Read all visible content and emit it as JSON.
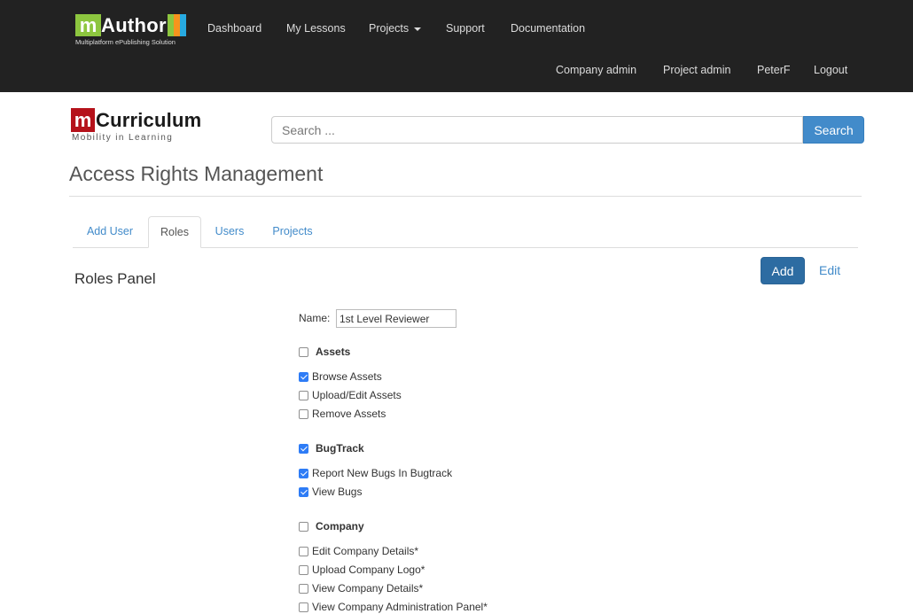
{
  "topnav": {
    "brand": {
      "letter": "m",
      "name": "Author",
      "subtitle": "Multiplatform ePublishing Solution",
      "bar_colors": [
        "#8dc63f",
        "#f7941d",
        "#27aae1"
      ]
    },
    "links": [
      "Dashboard",
      "My Lessons",
      "Projects",
      "Support",
      "Documentation"
    ],
    "user_links": [
      "Company admin",
      "Project admin",
      "PeterF",
      "Logout"
    ]
  },
  "header": {
    "logo": {
      "letter": "m",
      "name": "Curriculum",
      "subtitle": "Mobility in Learning"
    },
    "search": {
      "placeholder": "Search ...",
      "button_label": "Search"
    }
  },
  "page": {
    "title": "Access Rights Management",
    "tabs": [
      {
        "label": "Add User",
        "active": false
      },
      {
        "label": "Roles",
        "active": true
      },
      {
        "label": "Users",
        "active": false
      },
      {
        "label": "Projects",
        "active": false
      }
    ],
    "panel_title": "Roles Panel",
    "add_label": "Add",
    "edit_label": "Edit",
    "name_label": "Name:",
    "name_value": "1st Level Reviewer"
  },
  "permissions": {
    "assets": {
      "label": "Assets",
      "checked": false,
      "items": [
        {
          "label": "Browse Assets",
          "checked": true
        },
        {
          "label": "Upload/Edit Assets",
          "checked": false
        },
        {
          "label": "Remove Assets",
          "checked": false
        }
      ]
    },
    "bugtrack": {
      "label": "BugTrack",
      "checked": true,
      "items": [
        {
          "label": "Report New Bugs In Bugtrack",
          "checked": true
        },
        {
          "label": "View Bugs",
          "checked": true
        }
      ]
    },
    "company": {
      "label": "Company",
      "checked": false,
      "items": [
        {
          "label": "Edit Company Details*",
          "checked": false
        },
        {
          "label": "Upload Company Logo*",
          "checked": false
        },
        {
          "label": "View Company Details*",
          "checked": false
        },
        {
          "label": "View Company Administration Panel*",
          "checked": false
        }
      ]
    }
  },
  "colors": {
    "navbar": "#222222",
    "link": "#428bca",
    "primary_button": "#2d6ca2",
    "checkbox_checked": "#2e7cf6"
  }
}
